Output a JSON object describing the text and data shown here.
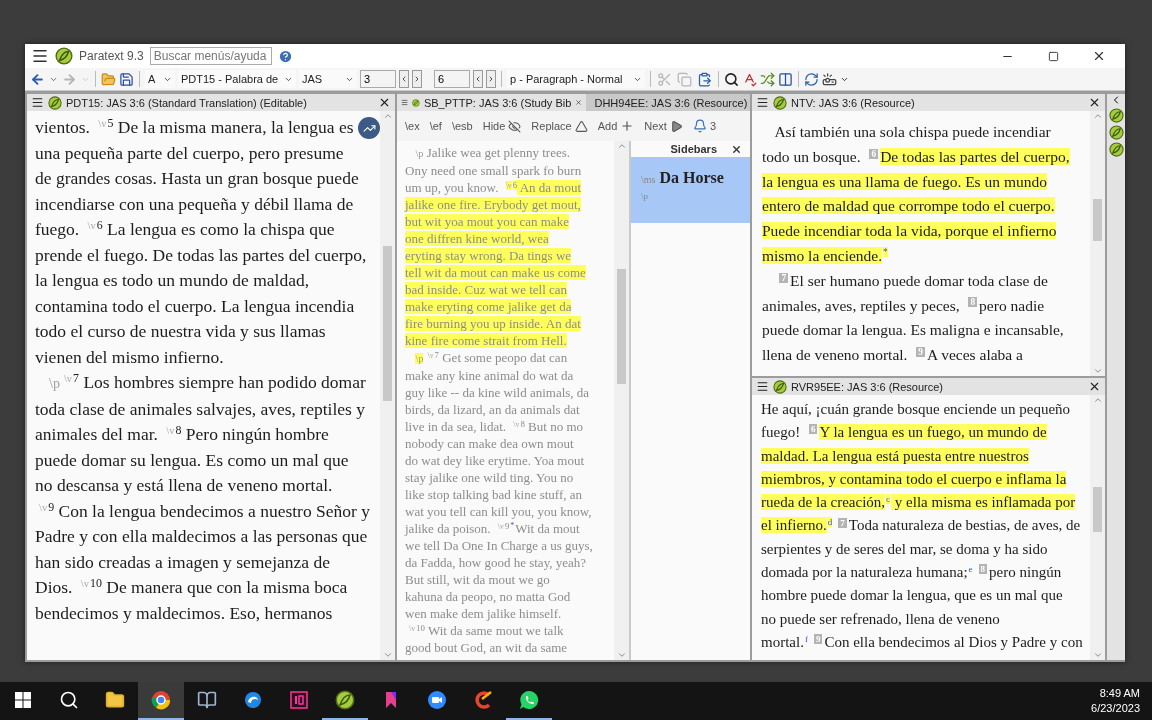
{
  "window": {
    "app_title": "Paratext 9.3",
    "search": {
      "placeholder": "Buscar menús/ayuda"
    }
  },
  "toolbar": {
    "nav": [
      {
        "disabled": false
      },
      {
        "disabled": true
      }
    ],
    "font": "A",
    "project": "PDT15 - Palabra de",
    "book": "JAS",
    "chapter": "3",
    "verse": "6",
    "paragraph_style": "p - Paragraph - Normal",
    "edit": [
      {
        "disabled": true
      },
      {
        "disabled": true
      },
      {
        "disabled": false
      }
    ]
  },
  "left_pane": {
    "title": "PDT15: JAS 3:6 (Standard Translation) (Editable)",
    "lines": [
      {
        "paragraph_start": false,
        "segments": [
          {
            "kind": "text",
            "text": "vientos. ",
            "highlighted": false
          },
          {
            "kind": "marker",
            "text": "\\v",
            "highlighted": false
          },
          {
            "kind": "verse",
            "text": "5",
            "highlighted": false
          },
          {
            "kind": "text",
            "text": " De la misma manera, la lengua es",
            "highlighted": false
          }
        ]
      },
      {
        "paragraph_start": false,
        "segments": [
          {
            "kind": "text",
            "text": "una pequeña parte del cuerpo, pero presume",
            "highlighted": false
          }
        ]
      },
      {
        "paragraph_start": false,
        "segments": [
          {
            "kind": "text",
            "text": "de grandes cosas. Hasta un gran bosque puede",
            "highlighted": false
          }
        ]
      },
      {
        "paragraph_start": false,
        "segments": [
          {
            "kind": "text",
            "text": "incendiarse con una pequeña y débil llama de",
            "highlighted": false
          }
        ]
      },
      {
        "paragraph_start": false,
        "segments": [
          {
            "kind": "text",
            "text": "fuego. ",
            "highlighted": false
          },
          {
            "kind": "marker",
            "text": "\\v",
            "highlighted": false
          },
          {
            "kind": "verse",
            "text": "6",
            "highlighted": false
          },
          {
            "kind": "text",
            "text": " La lengua es como la chispa que",
            "highlighted": false
          }
        ]
      },
      {
        "paragraph_start": false,
        "segments": [
          {
            "kind": "text",
            "text": "prende el fuego. De todas las partes del cuerpo,",
            "highlighted": false
          }
        ]
      },
      {
        "paragraph_start": false,
        "segments": [
          {
            "kind": "text",
            "text": "la lengua es todo un mundo de maldad,",
            "highlighted": false
          }
        ]
      },
      {
        "paragraph_start": false,
        "segments": [
          {
            "kind": "text",
            "text": "contamina todo el cuerpo. La lengua incendia",
            "highlighted": false
          }
        ]
      },
      {
        "paragraph_start": false,
        "segments": [
          {
            "kind": "text",
            "text": "todo el curso de nuestra vida y sus llamas",
            "highlighted": false
          }
        ]
      },
      {
        "paragraph_start": false,
        "segments": [
          {
            "kind": "text",
            "text": "vienen del mismo infierno.",
            "highlighted": false
          }
        ]
      },
      {
        "paragraph_start": true,
        "segments": [
          {
            "kind": "para_marker",
            "text": "\\p",
            "highlighted": false
          },
          {
            "kind": "marker",
            "text": "\\v",
            "highlighted": false
          },
          {
            "kind": "verse",
            "text": "7",
            "highlighted": false
          },
          {
            "kind": "text",
            "text": " Los hombres siempre han podido domar",
            "highlighted": false
          }
        ]
      },
      {
        "paragraph_start": false,
        "segments": [
          {
            "kind": "text",
            "text": "toda clase de animales salvajes, aves, reptiles y",
            "highlighted": false
          }
        ]
      },
      {
        "paragraph_start": false,
        "segments": [
          {
            "kind": "text",
            "text": "animales del mar. ",
            "highlighted": false
          },
          {
            "kind": "marker",
            "text": "\\v",
            "highlighted": false
          },
          {
            "kind": "verse",
            "text": "8",
            "highlighted": false
          },
          {
            "kind": "text",
            "text": " Pero ningún hombre",
            "highlighted": false
          }
        ]
      },
      {
        "paragraph_start": false,
        "segments": [
          {
            "kind": "text",
            "text": "puede domar su lengua. Es como un mal que",
            "highlighted": false
          }
        ]
      },
      {
        "paragraph_start": false,
        "segments": [
          {
            "kind": "text",
            "text": "no descansa y está llena de veneno mortal.",
            "highlighted": false
          }
        ]
      },
      {
        "paragraph_start": false,
        "segments": [
          {
            "kind": "marker",
            "text": "\\v",
            "highlighted": false
          },
          {
            "kind": "verse",
            "text": "9",
            "highlighted": false
          },
          {
            "kind": "text",
            "text": " Con la lengua bendecimos a nuestro Señor y",
            "highlighted": false
          }
        ]
      },
      {
        "paragraph_start": false,
        "segments": [
          {
            "kind": "text",
            "text": "Padre y con ella maldecimos a las personas que",
            "highlighted": false
          }
        ]
      },
      {
        "paragraph_start": false,
        "segments": [
          {
            "kind": "text",
            "text": "han sido creadas a imagen y semejanza de",
            "highlighted": false
          }
        ]
      },
      {
        "paragraph_start": false,
        "segments": [
          {
            "kind": "text",
            "text": "Dios. ",
            "highlighted": false
          },
          {
            "kind": "marker",
            "text": "\\v",
            "highlighted": false
          },
          {
            "kind": "verse",
            "text": "10",
            "highlighted": false
          },
          {
            "kind": "text",
            "text": " De manera que con la misma boca",
            "highlighted": false
          }
        ]
      },
      {
        "paragraph_start": false,
        "segments": [
          {
            "kind": "text",
            "text": "bendecimos y maldecimos. Eso, hermanos",
            "highlighted": false
          }
        ]
      }
    ]
  },
  "study_pane": {
    "tabs": [
      {
        "label": "SB_PTTP: JAS 3:6 (Study Bib",
        "selected": true
      },
      {
        "label": "DHH94EE: JAS 3:6 (Resource)",
        "selected": false
      }
    ],
    "tools": [
      {
        "kind": "marker",
        "label": "\\ex"
      },
      {
        "kind": "marker",
        "label": "\\ef"
      },
      {
        "kind": "marker",
        "label": "\\esb"
      },
      {
        "kind": "hide",
        "label": "Hide"
      },
      {
        "kind": "replace",
        "label": "Replace"
      },
      {
        "kind": "add",
        "label": "Add"
      },
      {
        "kind": "next",
        "label": "Next"
      },
      {
        "kind": "notifications",
        "label": "3"
      }
    ],
    "lines": [
      {
        "paragraph_start": true,
        "segments": [
          {
            "kind": "para_marker",
            "text": "\\p",
            "highlighted": false
          },
          {
            "kind": "text",
            "text": " Jalike wea get plenny trees.",
            "highlighted": false
          }
        ]
      },
      {
        "paragraph_start": false,
        "segments": [
          {
            "kind": "text",
            "text": "Ony need one small spark fo burn",
            "highlighted": false
          }
        ]
      },
      {
        "paragraph_start": false,
        "segments": [
          {
            "kind": "text",
            "text": "um up, you know. ",
            "highlighted": false
          },
          {
            "kind": "marker",
            "text": "\\v",
            "highlighted": true
          },
          {
            "kind": "verse",
            "text": "6",
            "highlighted": true
          },
          {
            "kind": "text",
            "text": " An da mout",
            "highlighted": true
          }
        ]
      },
      {
        "paragraph_start": false,
        "segments": [
          {
            "kind": "text",
            "text": "jalike one fire. Erybody get mout,",
            "highlighted": true
          }
        ]
      },
      {
        "paragraph_start": false,
        "segments": [
          {
            "kind": "text",
            "text": "but wit yoa mout you can make",
            "highlighted": true
          }
        ]
      },
      {
        "paragraph_start": false,
        "segments": [
          {
            "kind": "text",
            "text": "one diffren kine world, wea",
            "highlighted": true
          }
        ]
      },
      {
        "paragraph_start": false,
        "segments": [
          {
            "kind": "text",
            "text": "eryting stay wrong. Da tings we",
            "highlighted": true
          }
        ]
      },
      {
        "paragraph_start": false,
        "segments": [
          {
            "kind": "text",
            "text": "tell wit da mout can make us come",
            "highlighted": true
          }
        ]
      },
      {
        "paragraph_start": false,
        "segments": [
          {
            "kind": "text",
            "text": "bad inside. Cuz wat we tell can",
            "highlighted": true
          }
        ]
      },
      {
        "paragraph_start": false,
        "segments": [
          {
            "kind": "text",
            "text": "make eryting come jalike get da",
            "highlighted": true
          }
        ]
      },
      {
        "paragraph_start": false,
        "segments": [
          {
            "kind": "text",
            "text": "fire burning you up inside. An dat",
            "highlighted": true
          }
        ]
      },
      {
        "paragraph_start": false,
        "segments": [
          {
            "kind": "text",
            "text": "kine fire come strait from Hell.",
            "highlighted": true
          }
        ]
      },
      {
        "paragraph_start": true,
        "segments": [
          {
            "kind": "para_marker",
            "text": "\\p",
            "highlighted": true
          },
          {
            "kind": "marker",
            "text": "\\v",
            "highlighted": false
          },
          {
            "kind": "verse",
            "text": "7",
            "highlighted": false
          },
          {
            "kind": "text",
            "text": " Get some peopo dat can",
            "highlighted": false
          }
        ]
      },
      {
        "paragraph_start": false,
        "segments": [
          {
            "kind": "text",
            "text": "make any kine animal do wat da",
            "highlighted": false
          }
        ]
      },
      {
        "paragraph_start": false,
        "segments": [
          {
            "kind": "text",
            "text": "guy like -- da kine wild animals, da",
            "highlighted": false
          }
        ]
      },
      {
        "paragraph_start": false,
        "segments": [
          {
            "kind": "text",
            "text": "birds, da lizard, an da animals dat",
            "highlighted": false
          }
        ]
      },
      {
        "paragraph_start": false,
        "segments": [
          {
            "kind": "text",
            "text": "live in da sea, lidat. ",
            "highlighted": false
          },
          {
            "kind": "marker",
            "text": "\\v",
            "highlighted": false
          },
          {
            "kind": "verse",
            "text": "8",
            "highlighted": false
          },
          {
            "kind": "text",
            "text": " But no mo",
            "highlighted": false
          }
        ]
      },
      {
        "paragraph_start": false,
        "segments": [
          {
            "kind": "text",
            "text": "nobody can make dea own mout",
            "highlighted": false
          }
        ]
      },
      {
        "paragraph_start": false,
        "segments": [
          {
            "kind": "text",
            "text": "do wat dey like erytime. Yoa mout",
            "highlighted": false
          }
        ]
      },
      {
        "paragraph_start": false,
        "segments": [
          {
            "kind": "text",
            "text": "stay jalike one wild ting. You no",
            "highlighted": false
          }
        ]
      },
      {
        "paragraph_start": false,
        "segments": [
          {
            "kind": "text",
            "text": "like stop talking bad kine stuff, an",
            "highlighted": false
          }
        ]
      },
      {
        "paragraph_start": false,
        "segments": [
          {
            "kind": "text",
            "text": "wat you tell can kill you, you know,",
            "highlighted": false
          }
        ]
      },
      {
        "paragraph_start": false,
        "segments": [
          {
            "kind": "text",
            "text": "jalike da poison. ",
            "highlighted": false
          },
          {
            "kind": "marker",
            "text": "\\v",
            "highlighted": false
          },
          {
            "kind": "verse",
            "text": "9",
            "highlighted": false
          },
          {
            "kind": "note",
            "text": "*",
            "highlighted": false
          },
          {
            "kind": "text",
            "text": "Wit da mout",
            "highlighted": false
          }
        ]
      },
      {
        "paragraph_start": false,
        "segments": [
          {
            "kind": "text",
            "text": "we tell Da One In Charge a us guys,",
            "highlighted": false
          }
        ]
      },
      {
        "paragraph_start": false,
        "segments": [
          {
            "kind": "text",
            "text": "da Fadda, how good he stay, yeah?",
            "highlighted": false
          }
        ]
      },
      {
        "paragraph_start": false,
        "segments": [
          {
            "kind": "text",
            "text": "But still, wit da mout we go",
            "highlighted": false
          }
        ]
      },
      {
        "paragraph_start": false,
        "segments": [
          {
            "kind": "text",
            "text": "kahuna da peopo, no matta God",
            "highlighted": false
          }
        ]
      },
      {
        "paragraph_start": false,
        "segments": [
          {
            "kind": "text",
            "text": "wen make dem jalike himself.",
            "highlighted": false
          }
        ]
      },
      {
        "paragraph_start": false,
        "segments": [
          {
            "kind": "marker",
            "text": "\\v",
            "highlighted": false
          },
          {
            "kind": "verse",
            "text": "10",
            "highlighted": false
          },
          {
            "kind": "text",
            "text": " Wit da same mout we talk",
            "highlighted": false
          }
        ]
      },
      {
        "paragraph_start": false,
        "segments": [
          {
            "kind": "text",
            "text": "good bout God, an wit da same",
            "highlighted": false
          }
        ]
      }
    ],
    "sidebars": {
      "title": "Sidebars",
      "items": [
        {
          "marker": "\\ms",
          "heading": "Da Horse",
          "paragraph_marker": "\\p",
          "selected": true
        }
      ]
    }
  },
  "ntv_pane": {
    "title": "NTV: JAS 3:6 (Resource)",
    "lines": [
      {
        "paragraph_start": true,
        "segments": [
          {
            "kind": "text",
            "text": "Así también una sola chispa puede incendiar",
            "highlighted": false
          }
        ]
      },
      {
        "paragraph_start": false,
        "segments": [
          {
            "kind": "text",
            "text": "todo un bosque. ",
            "highlighted": false
          },
          {
            "kind": "verse_box",
            "text": "6",
            "highlighted": false
          },
          {
            "kind": "text",
            "text": "De todas las partes del cuerpo,",
            "highlighted": true
          }
        ]
      },
      {
        "paragraph_start": false,
        "segments": [
          {
            "kind": "text",
            "text": "la lengua es una llama de fuego. Es un mundo",
            "highlighted": true
          }
        ]
      },
      {
        "paragraph_start": false,
        "segments": [
          {
            "kind": "text",
            "text": "entero de maldad que corrompe todo el cuerpo.",
            "highlighted": true
          }
        ]
      },
      {
        "paragraph_start": false,
        "segments": [
          {
            "kind": "text",
            "text": "Puede incendiar toda la vida, porque el infierno",
            "highlighted": true
          }
        ]
      },
      {
        "paragraph_start": false,
        "segments": [
          {
            "kind": "text",
            "text": "mismo la enciende.",
            "highlighted": true
          },
          {
            "kind": "note",
            "text": "*",
            "highlighted": true
          }
        ]
      },
      {
        "paragraph_start": true,
        "segments": [
          {
            "kind": "verse_box",
            "text": "7",
            "highlighted": false
          },
          {
            "kind": "text",
            "text": "El ser humano puede domar toda clase de",
            "highlighted": false
          }
        ]
      },
      {
        "paragraph_start": false,
        "segments": [
          {
            "kind": "text",
            "text": "animales, aves, reptiles y peces, ",
            "highlighted": false
          },
          {
            "kind": "verse_box",
            "text": "8",
            "highlighted": false
          },
          {
            "kind": "text",
            "text": "pero nadie",
            "highlighted": false
          }
        ]
      },
      {
        "paragraph_start": false,
        "segments": [
          {
            "kind": "text",
            "text": "puede domar la lengua. Es maligna e incansable,",
            "highlighted": false
          }
        ]
      },
      {
        "paragraph_start": false,
        "segments": [
          {
            "kind": "text",
            "text": "llena de veneno mortal. ",
            "highlighted": false
          },
          {
            "kind": "verse_box",
            "text": "9",
            "highlighted": false
          },
          {
            "kind": "text",
            "text": "A veces alaba a",
            "highlighted": false
          }
        ]
      }
    ]
  },
  "rvr_pane": {
    "title": "RVR95EE: JAS 3:6 (Resource)",
    "lines": [
      {
        "paragraph_start": false,
        "segments": [
          {
            "kind": "text",
            "text": "He aquí, ¡cuán grande bosque enciende un pequeño",
            "highlighted": false
          }
        ]
      },
      {
        "paragraph_start": false,
        "segments": [
          {
            "kind": "text",
            "text": "fuego! ",
            "highlighted": false
          },
          {
            "kind": "verse_box",
            "text": "6",
            "highlighted": false
          },
          {
            "kind": "text",
            "text": "Y la lengua es un fuego, un mundo de",
            "highlighted": true
          }
        ]
      },
      {
        "paragraph_start": false,
        "segments": [
          {
            "kind": "text",
            "text": "maldad. La lengua está puesta entre nuestros",
            "highlighted": true
          }
        ]
      },
      {
        "paragraph_start": false,
        "segments": [
          {
            "kind": "text",
            "text": "miembros, y contamina todo el cuerpo e inflama la",
            "highlighted": true
          }
        ]
      },
      {
        "paragraph_start": false,
        "segments": [
          {
            "kind": "text",
            "text": "rueda de la creación,",
            "highlighted": true
          },
          {
            "kind": "note",
            "text": "c",
            "highlighted": true
          },
          {
            "kind": "text",
            "text": " y ella misma es inflamada por",
            "highlighted": true
          }
        ]
      },
      {
        "paragraph_start": false,
        "segments": [
          {
            "kind": "text",
            "text": "el infierno.",
            "highlighted": true
          },
          {
            "kind": "note",
            "text": "d",
            "highlighted": true
          },
          {
            "kind": "verse_box",
            "text": "7",
            "highlighted": false
          },
          {
            "kind": "text",
            "text": "Toda naturaleza de bestias, de aves, de",
            "highlighted": false
          }
        ]
      },
      {
        "paragraph_start": false,
        "segments": [
          {
            "kind": "text",
            "text": "serpientes y de seres del mar, se doma y ha sido",
            "highlighted": false
          }
        ]
      },
      {
        "paragraph_start": false,
        "segments": [
          {
            "kind": "text",
            "text": "domada por la naturaleza humana;",
            "highlighted": false
          },
          {
            "kind": "note",
            "text": "e",
            "highlighted": false
          },
          {
            "kind": "verse_box",
            "text": "8",
            "highlighted": false
          },
          {
            "kind": "text",
            "text": "pero ningún",
            "highlighted": false
          }
        ]
      },
      {
        "paragraph_start": false,
        "segments": [
          {
            "kind": "text",
            "text": "hombre puede domar la lengua, que es un mal que",
            "highlighted": false
          }
        ]
      },
      {
        "paragraph_start": false,
        "segments": [
          {
            "kind": "text",
            "text": "no puede ser refrenado, llena de veneno",
            "highlighted": false
          }
        ]
      },
      {
        "paragraph_start": false,
        "segments": [
          {
            "kind": "text",
            "text": "mortal.",
            "highlighted": false
          },
          {
            "kind": "note",
            "text": "f",
            "highlighted": false
          },
          {
            "kind": "verse_box",
            "text": "9",
            "highlighted": false
          },
          {
            "kind": "text",
            "text": "Con ella bendecimos al Dios y Padre y con",
            "highlighted": false
          }
        ]
      }
    ]
  },
  "taskbar": {
    "apps": [
      {
        "running": false,
        "selected": false
      },
      {
        "running": true,
        "selected": true
      },
      {
        "running": false,
        "selected": false
      },
      {
        "running": false,
        "selected": false
      },
      {
        "running": false,
        "selected": false
      },
      {
        "running": true,
        "selected": false
      },
      {
        "running": false,
        "selected": false
      },
      {
        "running": false,
        "selected": false
      },
      {
        "running": false,
        "selected": false
      },
      {
        "running": true,
        "selected": false
      }
    ],
    "time": "8:49 AM",
    "date": "6/23/2023"
  }
}
